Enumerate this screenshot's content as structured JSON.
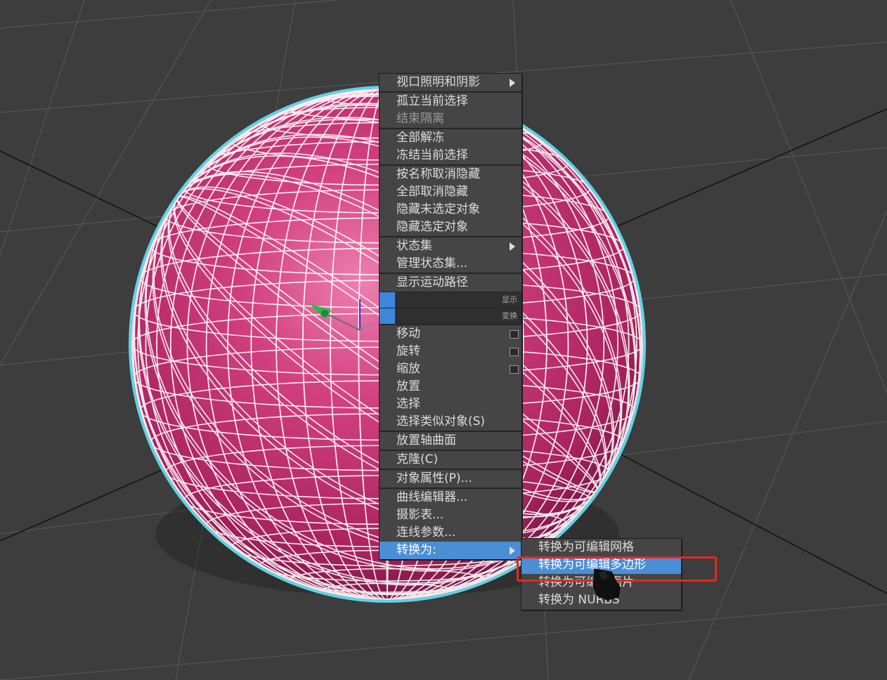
{
  "quad_menu": {
    "sections": [
      {
        "items": [
          {
            "label": "视口照明和阴影",
            "submenu": true
          }
        ]
      },
      {
        "items": [
          {
            "label": "孤立当前选择"
          },
          {
            "label": "结束隔离",
            "dim": true
          }
        ]
      },
      {
        "items": [
          {
            "label": "全部解冻"
          },
          {
            "label": "冻结当前选择"
          }
        ]
      },
      {
        "items": [
          {
            "label": "按名称取消隐藏"
          },
          {
            "label": "全部取消隐藏"
          },
          {
            "label": "隐藏未选定对象"
          },
          {
            "label": "隐藏选定对象"
          }
        ]
      },
      {
        "items": [
          {
            "label": "状态集",
            "submenu": true
          },
          {
            "label": "管理状态集..."
          }
        ]
      },
      {
        "items": [
          {
            "label": "显示运动路径"
          }
        ]
      }
    ],
    "header_display": "显示",
    "header_transform": "变换",
    "transform_sections": [
      {
        "items": [
          {
            "label": "移动",
            "checkbox": true
          },
          {
            "label": "旋转",
            "checkbox": true
          },
          {
            "label": "缩放",
            "checkbox": true
          },
          {
            "label": "放置"
          },
          {
            "label": "选择"
          },
          {
            "label": "选择类似对象(S)"
          }
        ]
      },
      {
        "items": [
          {
            "label": "放置轴曲面"
          }
        ]
      },
      {
        "items": [
          {
            "label": "克隆(C)"
          }
        ]
      },
      {
        "items": [
          {
            "label": "对象属性(P)..."
          }
        ]
      },
      {
        "items": [
          {
            "label": "曲线编辑器..."
          },
          {
            "label": "摄影表..."
          },
          {
            "label": "连线参数..."
          },
          {
            "label": "转换为:",
            "submenu": true,
            "highlighted": true
          }
        ]
      }
    ]
  },
  "convert_submenu": {
    "items": [
      {
        "label": "转换为可编辑网格"
      },
      {
        "label": "转换为可编辑多边形",
        "highlighted": true
      },
      {
        "label": "转换为可编辑面片"
      },
      {
        "label": "转换为 NURBS"
      }
    ]
  },
  "colors": {
    "background": "#3d3d3d",
    "sphere": "#c02d72",
    "sphere_outline": "#5fd3e6",
    "highlight": "#4a8ed6",
    "annotation_box": "#e6281f"
  },
  "icons": [
    "move-gizmo-icon",
    "mouse-cursor-icon",
    "submenu-arrow-icon"
  ]
}
